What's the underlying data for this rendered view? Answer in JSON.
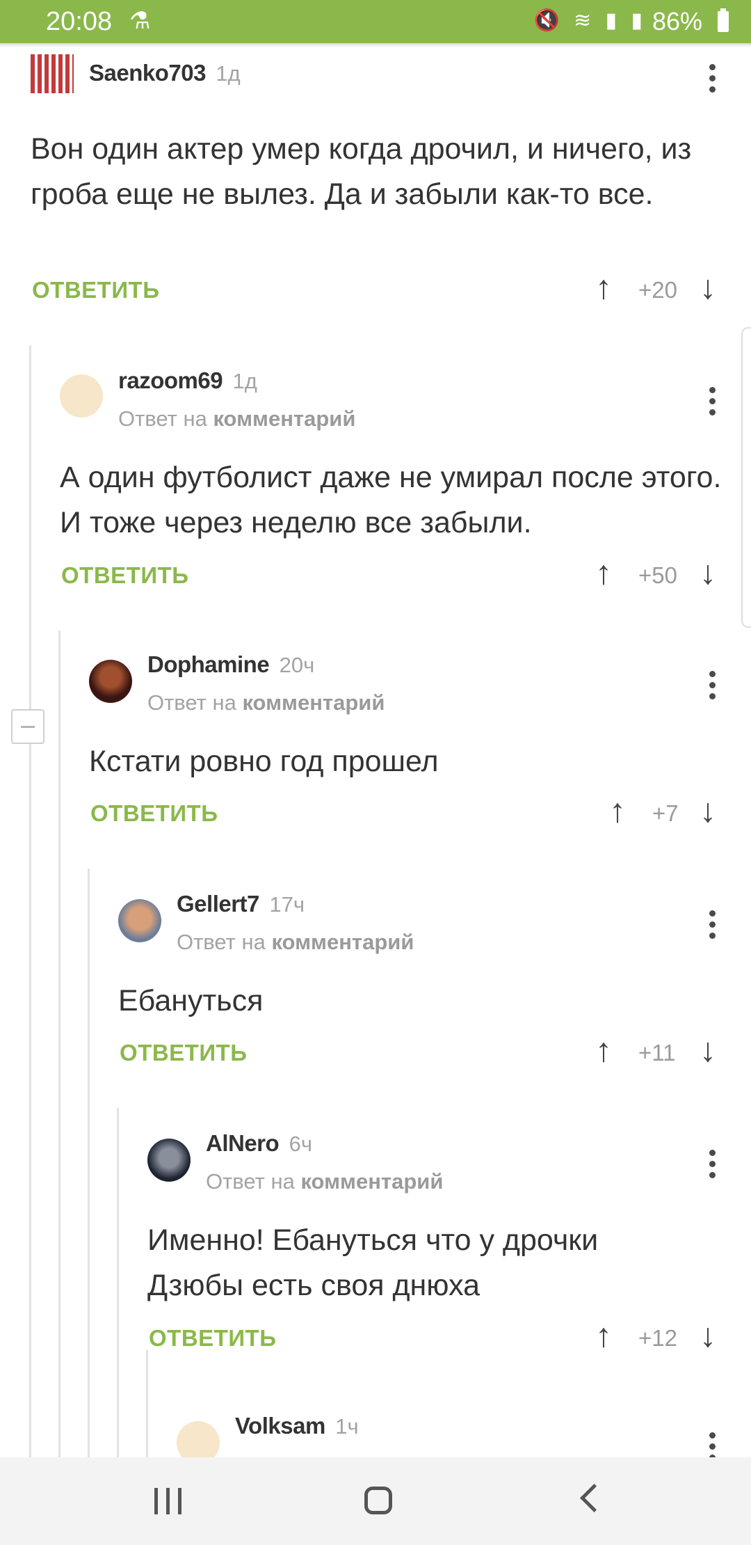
{
  "status_bar": {
    "time": "20:08",
    "battery": "86%",
    "icons": [
      "mute-icon",
      "wifi-icon",
      "signal-icon",
      "signal-icon",
      "battery-icon"
    ]
  },
  "reply_label": "ОТВЕТИТЬ",
  "reply_to_prefix": "Ответ на",
  "reply_to_link": "комментарий",
  "comments": [
    {
      "author": "Saenko703",
      "time": "1д",
      "text": "Вон один актер умер когда дрочил, и ничего, из гроба еще не вылез. Да и забыли как-то все.",
      "score": "+20"
    },
    {
      "author": "razoom69",
      "time": "1д",
      "text": "А один футболист даже не умирал после этого. И тоже через неделю все забыли.",
      "score": "+50"
    },
    {
      "author": "Dophamine",
      "time": "20ч",
      "text": "Кстати ровно год прошел",
      "score": "+7"
    },
    {
      "author": "Gellert7",
      "time": "17ч",
      "text": "Ебануться",
      "score": "+11"
    },
    {
      "author": "AlNero",
      "time": "6ч",
      "text": "Именно! Ебануться что у дрочки Дзюбы есть своя днюха",
      "score": "+12"
    },
    {
      "author": "Volksam",
      "time": "1ч"
    }
  ],
  "colors": {
    "accent": "#8ab84a",
    "status_bar": "#8ab84a",
    "muted_text": "#a3a3a3"
  }
}
